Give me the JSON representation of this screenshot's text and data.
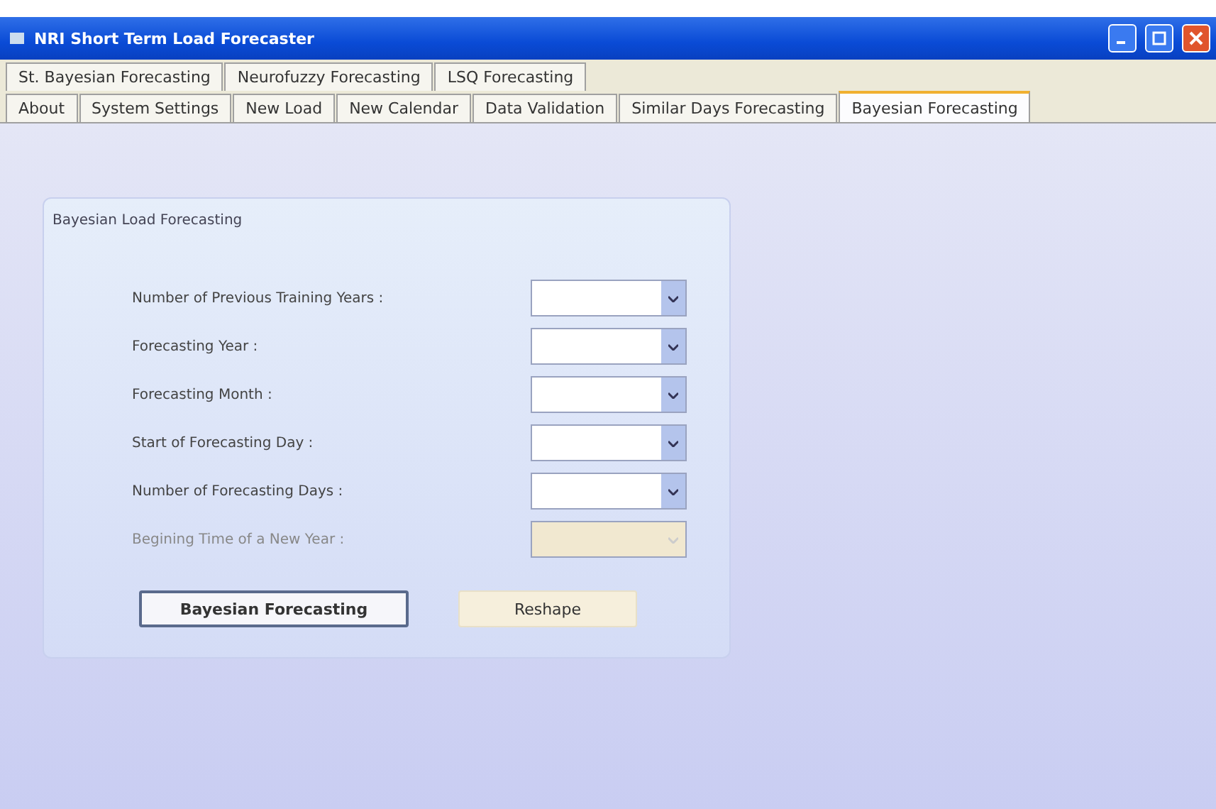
{
  "window": {
    "title": "NRI Short Term Load Forecaster"
  },
  "tab_rows": [
    [
      {
        "label": "St. Bayesian Forecasting",
        "selected": false
      },
      {
        "label": "Neurofuzzy Forecasting",
        "selected": false
      },
      {
        "label": "LSQ Forecasting",
        "selected": false
      }
    ],
    [
      {
        "label": "About",
        "selected": false
      },
      {
        "label": "System Settings",
        "selected": false
      },
      {
        "label": "New Load",
        "selected": false
      },
      {
        "label": "New Calendar",
        "selected": false
      },
      {
        "label": "Data Validation",
        "selected": false
      },
      {
        "label": "Similar Days Forecasting",
        "selected": false
      },
      {
        "label": "Bayesian Forecasting",
        "selected": true
      }
    ]
  ],
  "group": {
    "title": "Bayesian Load Forecasting",
    "fields": [
      {
        "label": "Number of Previous Training Years :",
        "disabled": false
      },
      {
        "label": "Forecasting Year :",
        "disabled": false
      },
      {
        "label": "Forecasting Month :",
        "disabled": false
      },
      {
        "label": "Start of Forecasting Day :",
        "disabled": false
      },
      {
        "label": "Number of Forecasting Days :",
        "disabled": false
      },
      {
        "label": "Begining Time of a New Year :",
        "disabled": true
      }
    ],
    "buttons": [
      {
        "label": "Bayesian Forecasting",
        "disabled": false
      },
      {
        "label": "Reshape",
        "disabled": true
      }
    ]
  }
}
